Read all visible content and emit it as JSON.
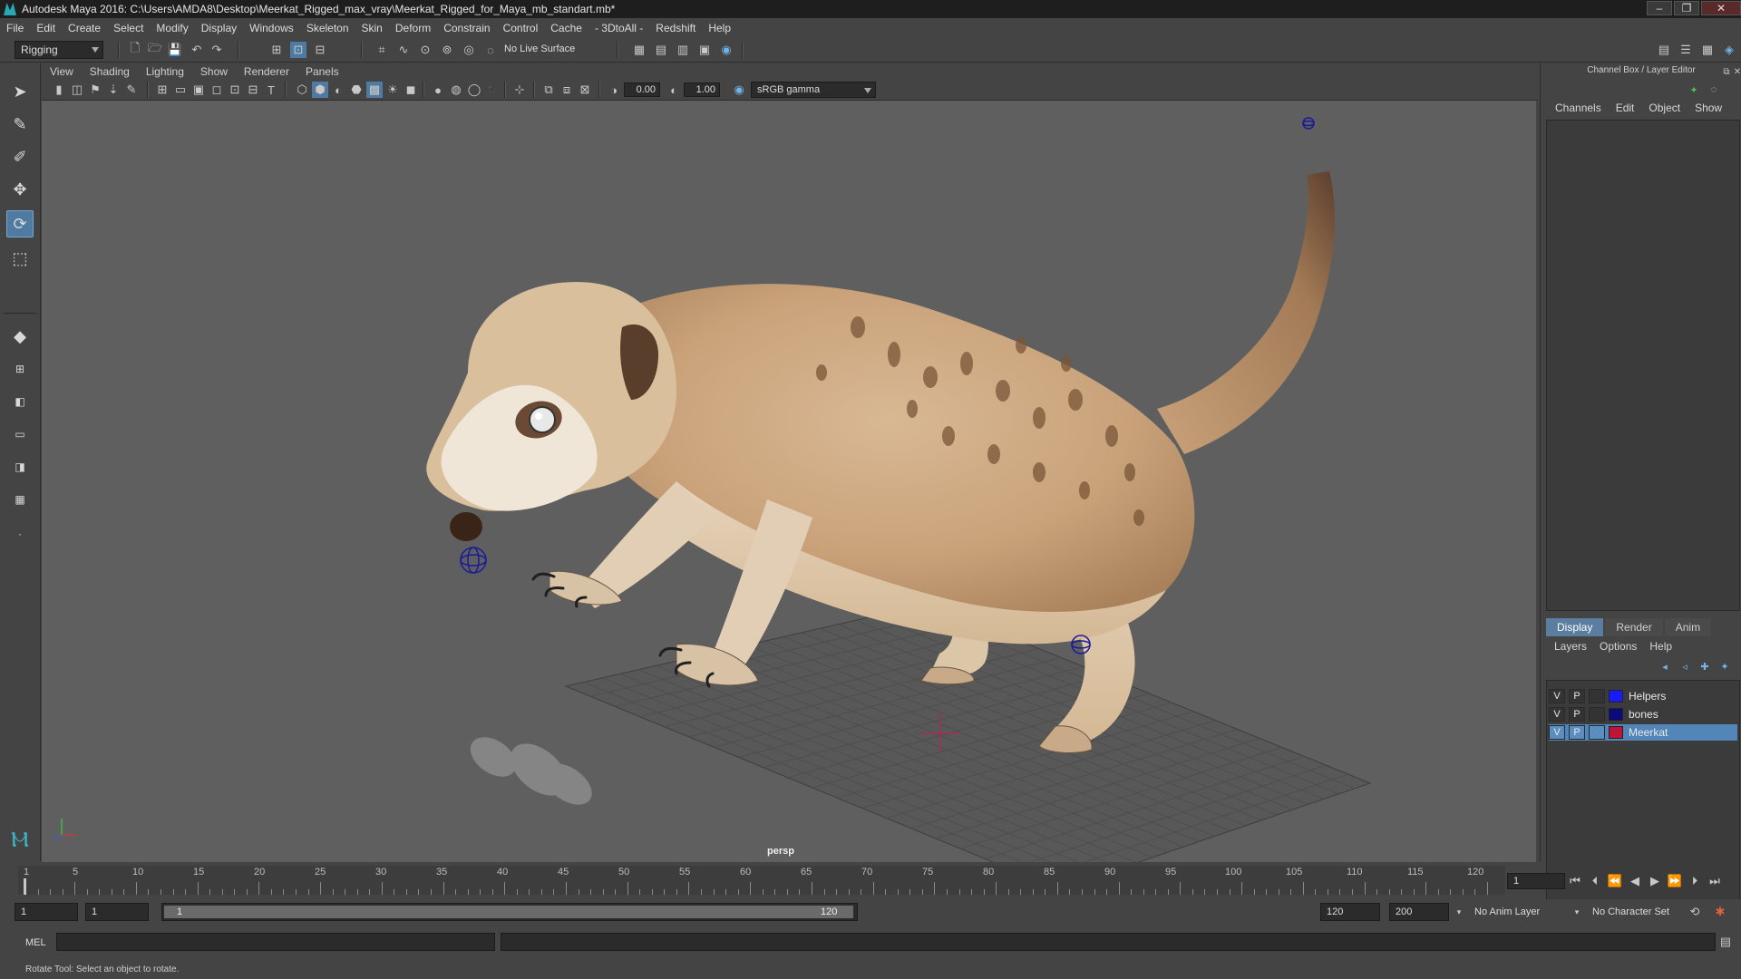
{
  "window": {
    "title": "Autodesk Maya 2016: C:\\Users\\AMDA8\\Desktop\\Meerkat_Rigged_max_vray\\Meerkat_Rigged_for_Maya_mb_standart.mb*"
  },
  "menus": [
    "File",
    "Edit",
    "Create",
    "Select",
    "Modify",
    "Display",
    "Windows",
    "Skeleton",
    "Skin",
    "Deform",
    "Constrain",
    "Control",
    "Cache",
    "- 3DtoAll -",
    "Redshift",
    "Help"
  ],
  "statusline": {
    "menuset": "Rigging",
    "live_surface": "No Live Surface"
  },
  "panel": {
    "menus": [
      "View",
      "Shading",
      "Lighting",
      "Show",
      "Renderer",
      "Panels"
    ],
    "exposure": "0.00",
    "gamma": "1.00",
    "colorspace": "sRGB gamma",
    "camera": "persp"
  },
  "channel_box": {
    "title": "Channel Box / Layer Editor",
    "menus": [
      "Channels",
      "Edit",
      "Object",
      "Show"
    ]
  },
  "layer_editor": {
    "tabs": [
      "Display",
      "Render",
      "Anim"
    ],
    "active_tab": "Display",
    "menus": [
      "Layers",
      "Options",
      "Help"
    ],
    "layers": [
      {
        "v": "V",
        "p": "P",
        "name": "Helpers",
        "color": "#1a1aff",
        "selected": false
      },
      {
        "v": "V",
        "p": "P",
        "name": "bones",
        "color": "#0a0a7a",
        "selected": false
      },
      {
        "v": "V",
        "p": "P",
        "name": "Meerkat",
        "color": "#c0133a",
        "selected": true
      }
    ]
  },
  "timeline": {
    "labels": [
      "1",
      "5",
      "10",
      "15",
      "20",
      "25",
      "30",
      "35",
      "40",
      "45",
      "50",
      "55",
      "60",
      "65",
      "70",
      "75",
      "80",
      "85",
      "90",
      "95",
      "100",
      "105",
      "110",
      "115",
      "120"
    ],
    "current_frame": "1"
  },
  "range": {
    "start": "1",
    "anim_start": "1",
    "slider_start": "1",
    "slider_end": "120",
    "playback_end": "120",
    "anim_end": "200",
    "anim_layer": "No Anim Layer",
    "character_set": "No Character Set"
  },
  "command": {
    "label": "MEL"
  },
  "help_line": "Rotate Tool: Select an object to rotate.",
  "colors": {
    "accent": "#5285b8",
    "viewport_bg": "#5f5f5f"
  }
}
